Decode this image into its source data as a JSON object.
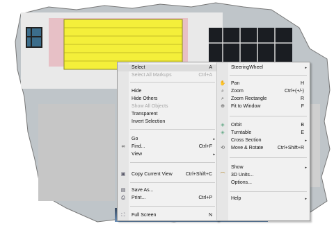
{
  "left_menu": {
    "items": [
      {
        "label": "Select",
        "shortcut": "A",
        "disabled": false
      },
      {
        "label": "Select All Markups",
        "shortcut": "Ctrl+A",
        "disabled": true
      },
      {
        "label": "Hide",
        "shortcut": "",
        "disabled": false
      },
      {
        "label": "Hide Others",
        "shortcut": "",
        "disabled": false
      },
      {
        "label": "Show All Objects",
        "shortcut": "",
        "disabled": true
      },
      {
        "label": "Transparent",
        "shortcut": "",
        "disabled": false
      },
      {
        "label": "Invert Selection",
        "shortcut": "",
        "disabled": false
      },
      {
        "label": "Go",
        "shortcut": "",
        "disabled": false,
        "submenu": true
      },
      {
        "label": "Find...",
        "shortcut": "Ctrl+F",
        "disabled": false
      },
      {
        "label": "View",
        "shortcut": "",
        "disabled": false,
        "submenu": true
      },
      {
        "label": "Copy Current View",
        "shortcut": "Ctrl+Shift+C",
        "disabled": false
      },
      {
        "label": "Save As...",
        "shortcut": "",
        "disabled": false
      },
      {
        "label": "Print...",
        "shortcut": "Ctrl+P",
        "disabled": false
      },
      {
        "label": "Full Screen",
        "shortcut": "N",
        "disabled": false
      }
    ]
  },
  "right_menu": {
    "items": [
      {
        "label": "SteeringWheel",
        "shortcut": "",
        "submenu": true
      },
      {
        "label": "Pan",
        "shortcut": "H"
      },
      {
        "label": "Zoom",
        "shortcut": "Ctrl+(+/-)"
      },
      {
        "label": "Zoom Rectangle",
        "shortcut": "R"
      },
      {
        "label": "Fit to Window",
        "shortcut": "F"
      },
      {
        "label": "Orbit",
        "shortcut": "B"
      },
      {
        "label": "Turntable",
        "shortcut": "E"
      },
      {
        "label": "Cross Section",
        "shortcut": "",
        "submenu": true
      },
      {
        "label": "Move & Rotate",
        "shortcut": "Ctrl+Shift+R"
      },
      {
        "label": "Show",
        "shortcut": "",
        "submenu": true
      },
      {
        "label": "3D Units...",
        "shortcut": ""
      },
      {
        "label": "Options...",
        "shortcut": ""
      },
      {
        "label": "Help",
        "shortcut": "",
        "submenu": true
      }
    ]
  },
  "submenu_arrow": "▸"
}
